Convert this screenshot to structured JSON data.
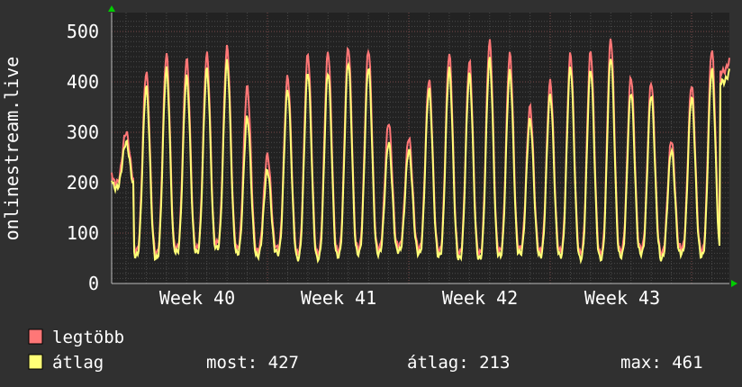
{
  "chart_data": {
    "type": "line",
    "title": "",
    "ylabel": "onlinestream.live",
    "xlabel": "",
    "ylim": [
      0,
      500
    ],
    "yticks": [
      "0",
      "100",
      "200",
      "300",
      "400",
      "500"
    ],
    "xticks": [
      "Week 40",
      "Week 41",
      "Week 42",
      "Week 43"
    ],
    "grid": true,
    "days": 31,
    "series": [
      {
        "name": "legtöbb",
        "color": "#ff7777",
        "daily_peaks": [
          300,
          420,
          455,
          445,
          455,
          468,
          390,
          255,
          410,
          455,
          460,
          470,
          465,
          320,
          290,
          405,
          455,
          440,
          480,
          455,
          350,
          400,
          455,
          460,
          485,
          410,
          400,
          285,
          395,
          465,
          450
        ],
        "daily_troughs": [
          200,
          65,
          60,
          70,
          70,
          80,
          70,
          65,
          70,
          60,
          60,
          65,
          70,
          70,
          75,
          70,
          65,
          60,
          60,
          65,
          70,
          65,
          65,
          60,
          60,
          65,
          70,
          60,
          70,
          65,
          420
        ]
      },
      {
        "name": "átlag",
        "color": "#ffff77",
        "daily_peaks": [
          280,
          390,
          425,
          410,
          425,
          440,
          330,
          225,
          385,
          420,
          420,
          440,
          430,
          280,
          265,
          385,
          425,
          415,
          445,
          420,
          325,
          375,
          430,
          425,
          450,
          380,
          375,
          265,
          370,
          425,
          427
        ],
        "daily_troughs": [
          190,
          55,
          50,
          62,
          62,
          70,
          60,
          55,
          60,
          50,
          50,
          55,
          60,
          60,
          65,
          60,
          55,
          50,
          50,
          55,
          60,
          55,
          55,
          50,
          50,
          55,
          60,
          50,
          60,
          55,
          400
        ]
      }
    ]
  },
  "legend": {
    "items": [
      {
        "label": "legtöbb",
        "color": "#ff7777"
      },
      {
        "label": "átlag",
        "color": "#ffff77"
      }
    ],
    "stats": {
      "most": "most: 427",
      "avg": "átlag: 213",
      "max": "max: 461"
    }
  }
}
